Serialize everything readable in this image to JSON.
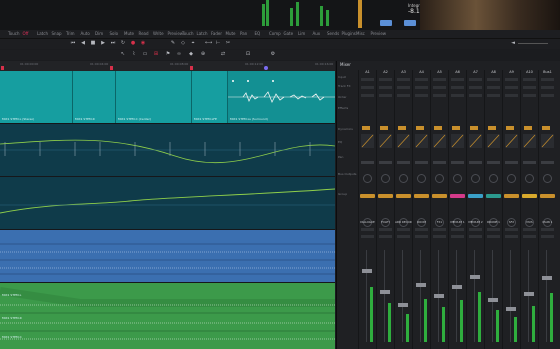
{
  "top_panel": {
    "meter_readout": "Integrated",
    "meter_value": "-8.1",
    "meters": [
      0.55,
      0.7,
      0.4,
      0.8
    ]
  },
  "toolbar": {
    "items": [
      "Touch",
      "Off",
      "Latch",
      "Snap",
      "Trim",
      "Auto",
      "Dim",
      "Solo",
      "Mute",
      "Read",
      "Write",
      "Preview",
      "Touch",
      "Latch",
      "Fader",
      "Mute",
      "Pan",
      "EQ",
      "Comp",
      "Gate",
      "Lim",
      "Aux",
      "Sends",
      "Plugins",
      "Misc",
      "Preview"
    ],
    "active_index": 1
  },
  "ruler": {
    "ticks": [
      "01:00:00:00",
      "01:00:04:00",
      "01:00:08:00",
      "01:00:12:00",
      "01:00:16:00"
    ]
  },
  "tracks": {
    "clip_labels": [
      "MIX1 STEM.L (Stereo)",
      "MIX1 STEM.R",
      "MIX1 STEM.C (Center)",
      "MIX1 STEM.LFE",
      "MIX1 STEM.Ls (Surround)"
    ],
    "lower_labels": [
      "MIX1 STEM.L",
      "MIX1 STEM.R",
      "MIX1 STEM.C"
    ]
  },
  "mixer": {
    "title": "Mixer",
    "row_labels": [
      "Input",
      "Track FX",
      "Order",
      "Effects",
      "Dynamics",
      "EQ",
      "Pan",
      "Bus Outputs",
      "Group"
    ],
    "channels": [
      {
        "id": "A1",
        "name": "DIALOGUE",
        "level": 0.78,
        "plugin_color": "#c9902c"
      },
      {
        "id": "A2",
        "name": "FOLEY",
        "level": 0.55,
        "plugin_color": "#c9902c"
      },
      {
        "id": "A3",
        "name": "ADR RECORD",
        "level": 0.4,
        "plugin_color": "#c9902c"
      },
      {
        "id": "A4",
        "name": "ROOM",
        "level": 0.62,
        "plugin_color": "#c9902c"
      },
      {
        "id": "A5",
        "name": "FX1",
        "level": 0.5,
        "plugin_color": "#c9902c"
      },
      {
        "id": "A6",
        "name": "MEDIUM 1",
        "level": 0.6,
        "plugin_color": "#d43a8a"
      },
      {
        "id": "A7",
        "name": "MEDIUM 2",
        "level": 0.72,
        "plugin_color": "#3aa0c8"
      },
      {
        "id": "A8",
        "name": "DRONE 1",
        "level": 0.45,
        "plugin_color": "#2b9a8e"
      },
      {
        "id": "A9",
        "name": "SFX",
        "level": 0.35,
        "plugin_color": "#c9902c"
      },
      {
        "id": "A10",
        "name": "MUS",
        "level": 0.52,
        "plugin_color": "#d8a92c"
      },
      {
        "id": "Bus1",
        "name": "MAIN 1",
        "level": 0.7,
        "plugin_color": "#c9902c"
      }
    ]
  }
}
